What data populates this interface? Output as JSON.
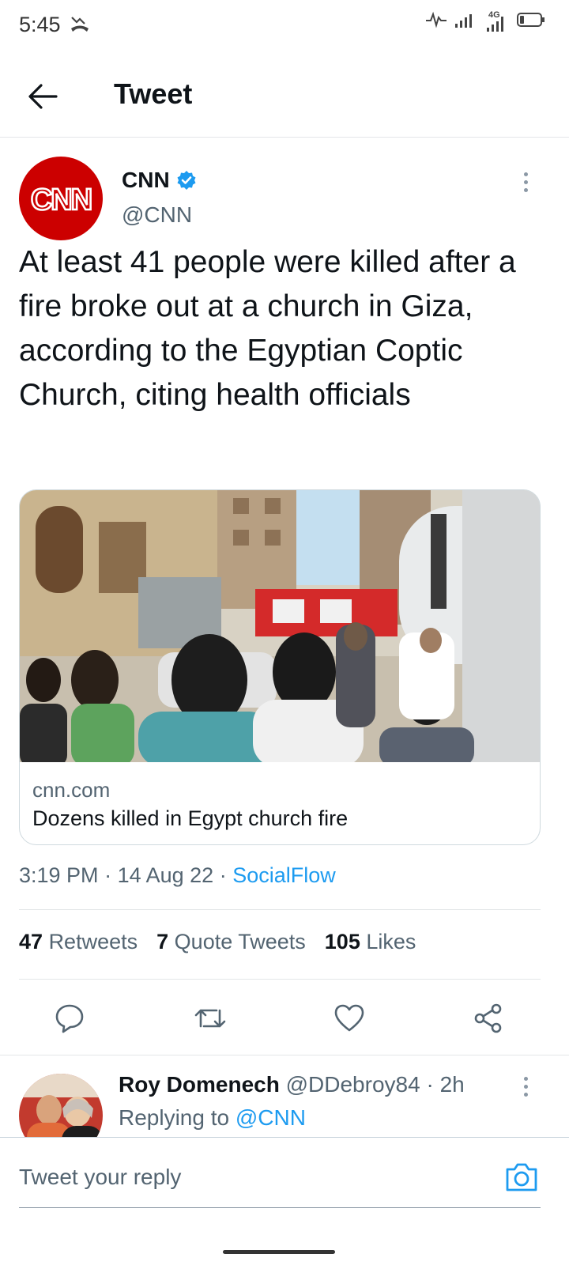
{
  "status_bar": {
    "time": "5:45",
    "network": "4G"
  },
  "header": {
    "title": "Tweet"
  },
  "tweet": {
    "author_name": "CNN",
    "author_handle": "@CNN",
    "avatar_text": "CNN",
    "text": "At least 41 people were killed after a fire broke out at a church in Giza, according to the Egyptian Coptic Church, citing health officials",
    "card": {
      "domain": "cnn.com",
      "title": "Dozens killed in Egypt church fire"
    },
    "time": "3:19 PM",
    "date": "14 Aug 22",
    "source": "SocialFlow",
    "stats": {
      "retweets_count": "47",
      "retweets_label": "Retweets",
      "quotes_count": "7",
      "quotes_label": "Quote Tweets",
      "likes_count": "105",
      "likes_label": "Likes"
    }
  },
  "reply": {
    "name": "Roy Domenech",
    "handle": "@DDebroy84",
    "time": "2h",
    "replying_label": "Replying to",
    "replying_handle": "@CNN"
  },
  "compose": {
    "placeholder": "Tweet your reply"
  },
  "colors": {
    "accent": "#1d9bf0",
    "cnn_red": "#cc0000",
    "secondary_text": "#536471"
  }
}
